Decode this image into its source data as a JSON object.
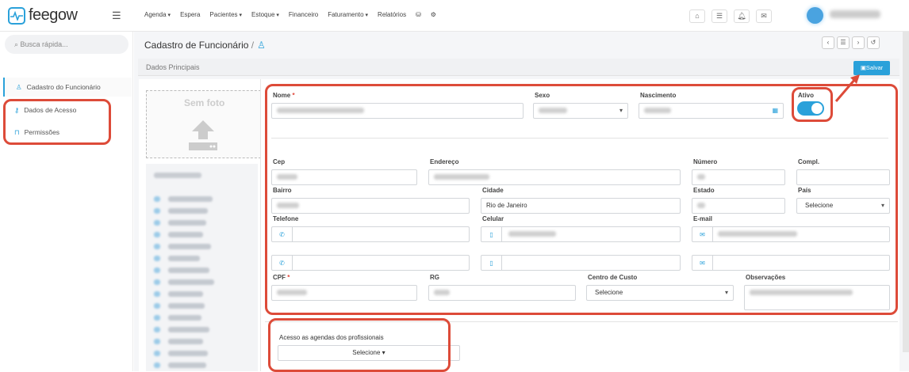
{
  "app": {
    "name": "feegow",
    "menu_icon": "hamburger-icon"
  },
  "nav": [
    "Agenda",
    "Espera",
    "Pacientes",
    "Estoque",
    "Financeiro",
    "Faturamento",
    "Relatórios"
  ],
  "search": {
    "placeholder": "Busca rápida..."
  },
  "sidebar": {
    "items": [
      {
        "label": "Cadastro do Funcionário",
        "icon": "person-icon"
      },
      {
        "label": "Dados de Acesso",
        "icon": "key-icon"
      },
      {
        "label": "Permissões",
        "icon": "lock-icon"
      }
    ]
  },
  "page": {
    "title": "Cadastro de Funcionário",
    "separator": "/",
    "section": "Dados Principais",
    "save_label": "Salvar",
    "photo_label": "Sem foto"
  },
  "form": {
    "nome_label": "Nome",
    "sexo_label": "Sexo",
    "nascimento_label": "Nascimento",
    "ativo_label": "Ativo",
    "ativo_value": true,
    "cep_label": "Cep",
    "endereco_label": "Endereço",
    "numero_label": "Número",
    "compl_label": "Compl.",
    "bairro_label": "Bairro",
    "cidade_label": "Cidade",
    "cidade_value": "Rio de Janeiro",
    "estado_label": "Estado",
    "pais_label": "País",
    "pais_value": "Selecione",
    "telefone_label": "Telefone",
    "celular_label": "Celular",
    "email_label": "E-mail",
    "cpf_label": "CPF",
    "rg_label": "RG",
    "centro_label": "Centro de Custo",
    "centro_value": "Selecione",
    "obs_label": "Observações",
    "acesso_label": "Acesso as agendas dos profissionais",
    "acesso_value": "Selecione"
  },
  "colors": {
    "accent": "#2aa1da",
    "highlight": "#dd4b39"
  }
}
